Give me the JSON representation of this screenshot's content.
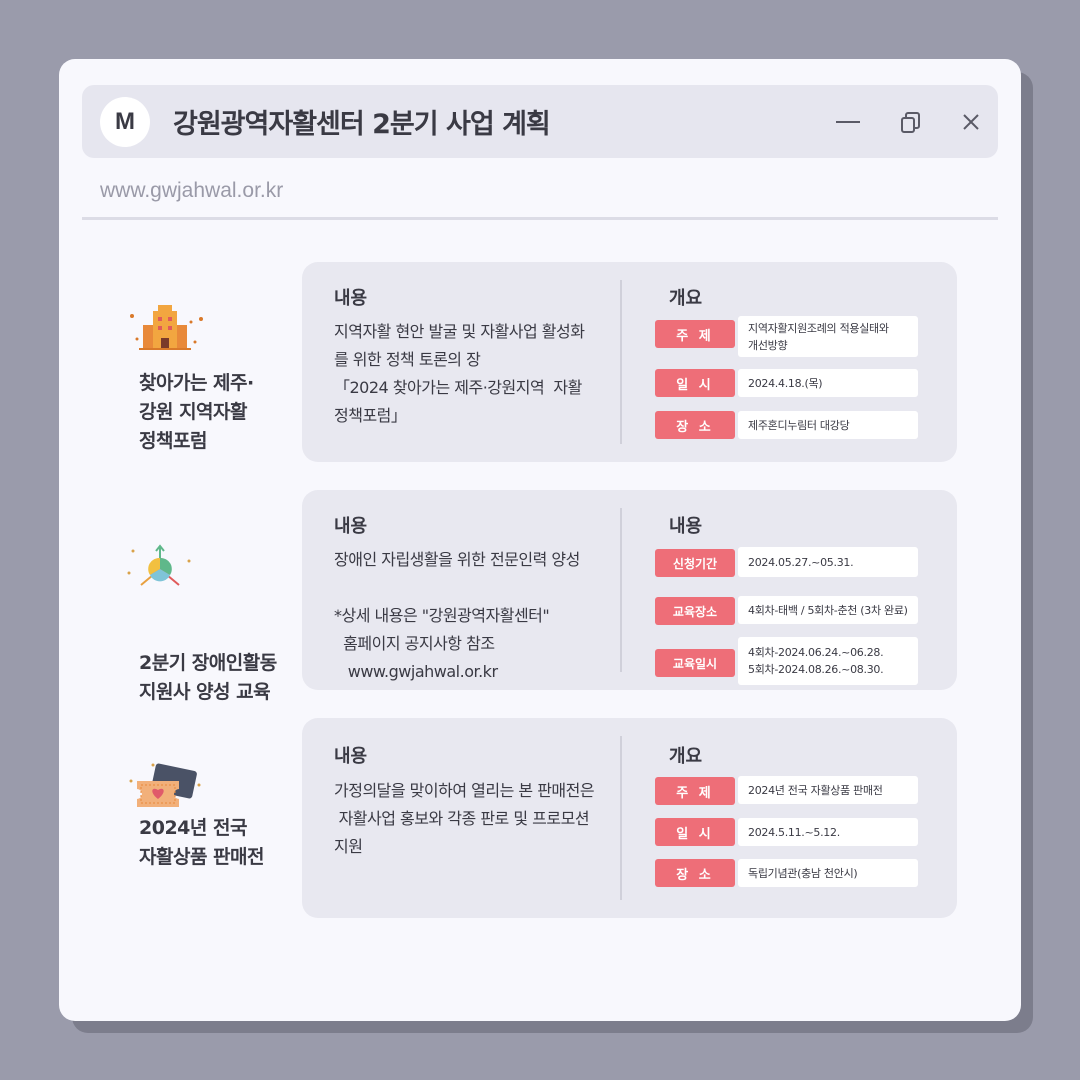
{
  "header": {
    "avatar_letter": "M",
    "title": "강원광역자활센터 2분기 사업 계획",
    "url": "www.gwjahwal.or.kr"
  },
  "icons": {
    "minimize": "minimize-icon",
    "copy": "copy-icon",
    "close": "close-icon",
    "section1": "building-icon",
    "section2": "people-network-icon",
    "section3": "ticket-heart-icon"
  },
  "colors": {
    "accent": "#ee6e78",
    "background": "#9a9bab",
    "window": "#f8f8fd",
    "card": "#e8e8f0"
  },
  "sections": [
    {
      "name": "찾아가는 제주·\n강원 지역자활\n정책포럼",
      "left_heading": "내용",
      "description": "지역자활 현안 발굴 및 자활사업 활성화\n를 위한 정책 토론의 장\n「2024 찾아가는 제주·강원지역  자활\n정책포럼」",
      "right_heading": "개요",
      "rows": [
        {
          "label": "주  제",
          "value": "지역자활지원조례의 적용실태와\n개선방향"
        },
        {
          "label": "일  시",
          "value": "2024.4.18.(목)"
        },
        {
          "label": "장  소",
          "value": "제주혼디누림터 대강당"
        }
      ]
    },
    {
      "name": "2분기 장애인활동\n지원사 양성 교육",
      "left_heading": "내용",
      "description": "장애인 자립생활을 위한 전문인력 양성\n\n*상세 내용은 \"강원광역자활센터\"\n  홈페이지 공지사항 참조\n   www.gwjahwal.or.kr",
      "right_heading": "내용",
      "rows": [
        {
          "label": "신청기간",
          "value": "2024.05.27.~05.31."
        },
        {
          "label": "교육장소",
          "value": "4회차-태백 / 5회차-춘천 (3차 완료)"
        },
        {
          "label": "교육일시",
          "value": "4회차-2024.06.24.~06.28.\n5회차-2024.08.26.~08.30."
        }
      ]
    },
    {
      "name": "2024년 전국\n자활상품  판매전",
      "left_heading": "내용",
      "description": "가정의달을 맞이하여 열리는 본 판매전은\n 자활사업 홍보와 각종 판로 및 프로모션\n지원",
      "right_heading": "개요",
      "rows": [
        {
          "label": "주  제",
          "value": "2024년 전국 자활상품 판매전"
        },
        {
          "label": "일  시",
          "value": "2024.5.11.~5.12."
        },
        {
          "label": "장  소",
          "value": "독립기념관(충남 천안시)"
        }
      ]
    }
  ]
}
